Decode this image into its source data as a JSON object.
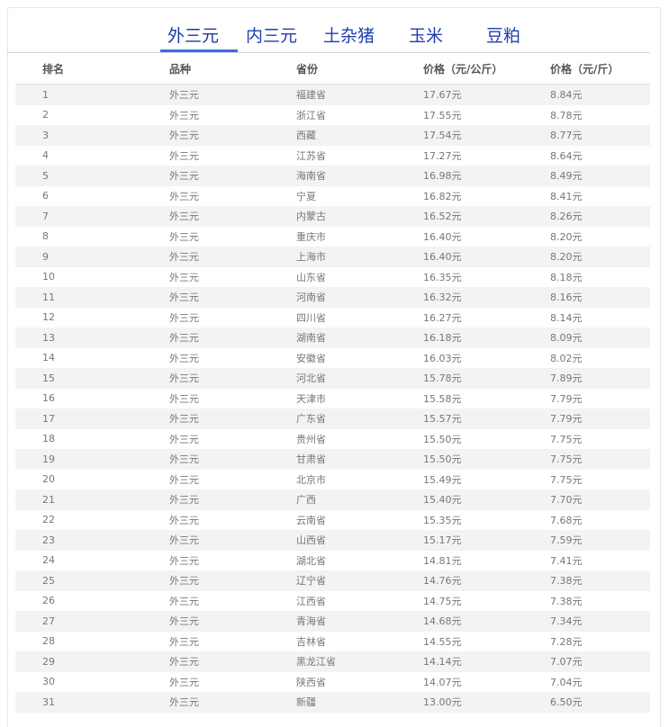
{
  "tabs": [
    {
      "label": "外三元",
      "active": true
    },
    {
      "label": "内三元",
      "active": false
    },
    {
      "label": "土杂猪",
      "active": false
    },
    {
      "label": "玉米",
      "active": false
    },
    {
      "label": "豆粕",
      "active": false
    }
  ],
  "table": {
    "headers": [
      "排名",
      "品种",
      "省份",
      "价格（元/公斤）",
      "价格（元/斤）"
    ],
    "rows": [
      [
        "1",
        "外三元",
        "福建省",
        "17.67元",
        "8.84元"
      ],
      [
        "2",
        "外三元",
        "浙江省",
        "17.55元",
        "8.78元"
      ],
      [
        "3",
        "外三元",
        "西藏",
        "17.54元",
        "8.77元"
      ],
      [
        "4",
        "外三元",
        "江苏省",
        "17.27元",
        "8.64元"
      ],
      [
        "5",
        "外三元",
        "海南省",
        "16.98元",
        "8.49元"
      ],
      [
        "6",
        "外三元",
        "宁夏",
        "16.82元",
        "8.41元"
      ],
      [
        "7",
        "外三元",
        "内蒙古",
        "16.52元",
        "8.26元"
      ],
      [
        "8",
        "外三元",
        "重庆市",
        "16.40元",
        "8.20元"
      ],
      [
        "9",
        "外三元",
        "上海市",
        "16.40元",
        "8.20元"
      ],
      [
        "10",
        "外三元",
        "山东省",
        "16.35元",
        "8.18元"
      ],
      [
        "11",
        "外三元",
        "河南省",
        "16.32元",
        "8.16元"
      ],
      [
        "12",
        "外三元",
        "四川省",
        "16.27元",
        "8.14元"
      ],
      [
        "13",
        "外三元",
        "湖南省",
        "16.18元",
        "8.09元"
      ],
      [
        "14",
        "外三元",
        "安徽省",
        "16.03元",
        "8.02元"
      ],
      [
        "15",
        "外三元",
        "河北省",
        "15.78元",
        "7.89元"
      ],
      [
        "16",
        "外三元",
        "天津市",
        "15.58元",
        "7.79元"
      ],
      [
        "17",
        "外三元",
        "广东省",
        "15.57元",
        "7.79元"
      ],
      [
        "18",
        "外三元",
        "贵州省",
        "15.50元",
        "7.75元"
      ],
      [
        "19",
        "外三元",
        "甘肃省",
        "15.50元",
        "7.75元"
      ],
      [
        "20",
        "外三元",
        "北京市",
        "15.49元",
        "7.75元"
      ],
      [
        "21",
        "外三元",
        "广西",
        "15.40元",
        "7.70元"
      ],
      [
        "22",
        "外三元",
        "云南省",
        "15.35元",
        "7.68元"
      ],
      [
        "23",
        "外三元",
        "山西省",
        "15.17元",
        "7.59元"
      ],
      [
        "24",
        "外三元",
        "湖北省",
        "14.81元",
        "7.41元"
      ],
      [
        "25",
        "外三元",
        "辽宁省",
        "14.76元",
        "7.38元"
      ],
      [
        "26",
        "外三元",
        "江西省",
        "14.75元",
        "7.38元"
      ],
      [
        "27",
        "外三元",
        "青海省",
        "14.68元",
        "7.34元"
      ],
      [
        "28",
        "外三元",
        "吉林省",
        "14.55元",
        "7.28元"
      ],
      [
        "29",
        "外三元",
        "黑龙江省",
        "14.14元",
        "7.07元"
      ],
      [
        "30",
        "外三元",
        "陕西省",
        "14.07元",
        "7.04元"
      ],
      [
        "31",
        "外三元",
        "新疆",
        "13.00元",
        "6.50元"
      ]
    ]
  }
}
